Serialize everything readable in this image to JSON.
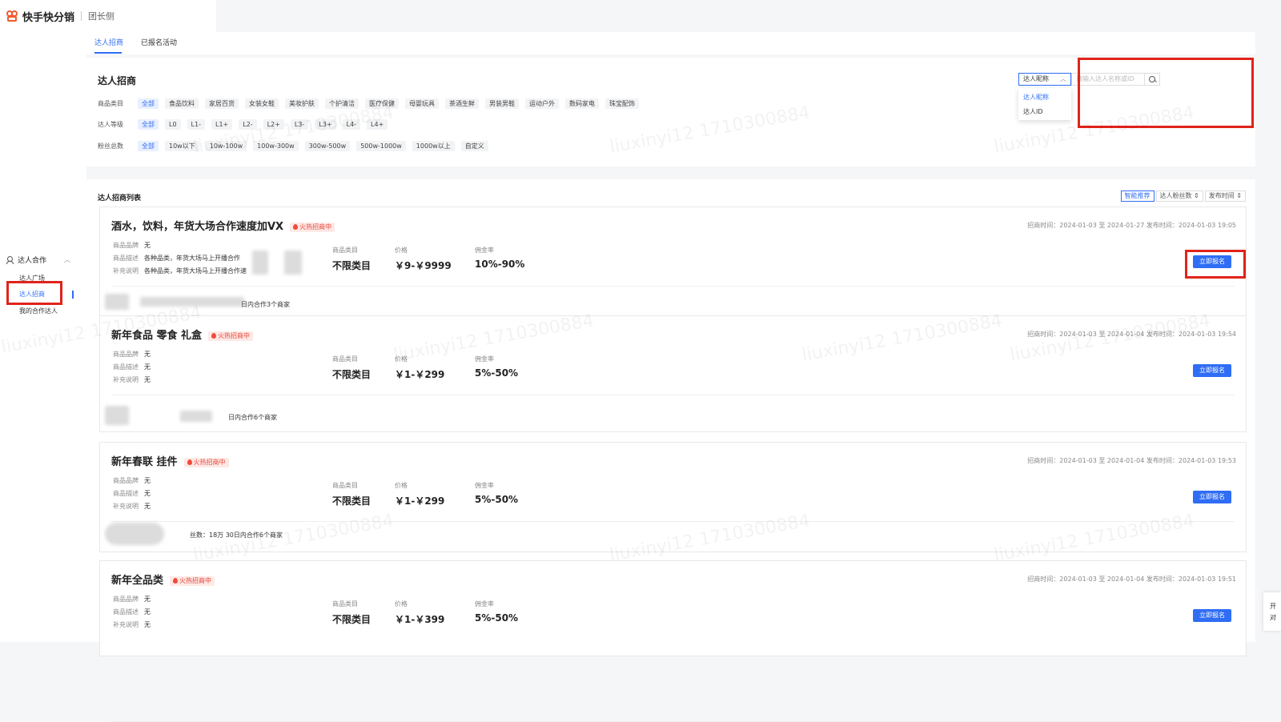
{
  "app": {
    "brand": "快手快分销",
    "role": "团长侧"
  },
  "sidebar": {
    "group_label": "达人合作",
    "items": [
      {
        "label": "达人广场"
      },
      {
        "label": "达人招商"
      },
      {
        "label": "我的合作达人"
      }
    ]
  },
  "tabs": [
    {
      "label": "达人招商"
    },
    {
      "label": "已报名活动"
    }
  ],
  "filters": {
    "title": "达人招商",
    "category": {
      "label": "商品类目",
      "options": [
        "全部",
        "食品饮料",
        "家居百货",
        "女装女鞋",
        "美妆护肤",
        "个护清洁",
        "医疗保健",
        "母婴玩具",
        "茶酒生鲜",
        "男装男鞋",
        "运动户外",
        "数码家电",
        "珠宝配饰"
      ]
    },
    "level": {
      "label": "达人等级",
      "options": [
        "全部",
        "L0",
        "L1-",
        "L1+",
        "L2-",
        "L2+",
        "L3-",
        "L3+",
        "L4-",
        "L4+"
      ]
    },
    "fans": {
      "label": "粉丝总数",
      "options": [
        "全部",
        "10w以下",
        "10w-100w",
        "100w-300w",
        "300w-500w",
        "500w-1000w",
        "1000w以上",
        "自定义"
      ]
    }
  },
  "search": {
    "select_value": "达人昵称",
    "placeholder": "请输入达人名称或ID",
    "dropdown_options": [
      "达人昵称",
      "达人ID"
    ]
  },
  "list": {
    "title": "达人招商列表",
    "sorts": [
      "智能推荐",
      "达人粉丝数 ⇕",
      "发布时间 ⇕"
    ],
    "labels": {
      "brand": "商品品牌",
      "desc": "商品描述",
      "note": "补充说明",
      "category": "商品类目",
      "price": "价格",
      "commission": "佣金率",
      "join": "立即报名"
    },
    "hot_tag": "火热招商中",
    "cards": [
      {
        "title": "酒水，饮料，年货大场合作速度加VX",
        "dates": "招商时间：2024-01-03 至 2024-01-27   发布时间：2024-01-03 19:05",
        "brand": "无",
        "desc": "各种品类，年货大场马上开播合作",
        "note": "各种品类，年货大场马上开播合作速",
        "category": "不限类目",
        "price": "￥9-￥9999",
        "commission": "10%-90%",
        "footer": "日内合作3个商家"
      },
      {
        "title": "新年食品 零食 礼盒",
        "dates": "招商时间：2024-01-03 至 2024-01-04   发布时间：2024-01-03 19:54",
        "brand": "无",
        "desc": "无",
        "note": "无",
        "category": "不限类目",
        "price": "￥1-￥299",
        "commission": "5%-50%",
        "footer": "日内合作6个商家"
      },
      {
        "title": "新年春联 挂件",
        "dates": "招商时间：2024-01-03 至 2024-01-04   发布时间：2024-01-03 19:53",
        "brand": "无",
        "desc": "无",
        "note": "无",
        "category": "不限类目",
        "price": "￥1-￥299",
        "commission": "5%-50%",
        "footer": "丝数：18万   30日内合作6个商家"
      },
      {
        "title": "新年全品类",
        "dates": "招商时间：2024-01-03 至 2024-01-04   发布时间：2024-01-03 19:51",
        "brand": "无",
        "desc": "无",
        "note": "无",
        "category": "不限类目",
        "price": "￥1-￥399",
        "commission": "5%-50%",
        "footer": ""
      }
    ]
  },
  "watermark": "liuxinyi12 1710300884",
  "float_tip": {
    "line1": "开",
    "line2": "对"
  }
}
